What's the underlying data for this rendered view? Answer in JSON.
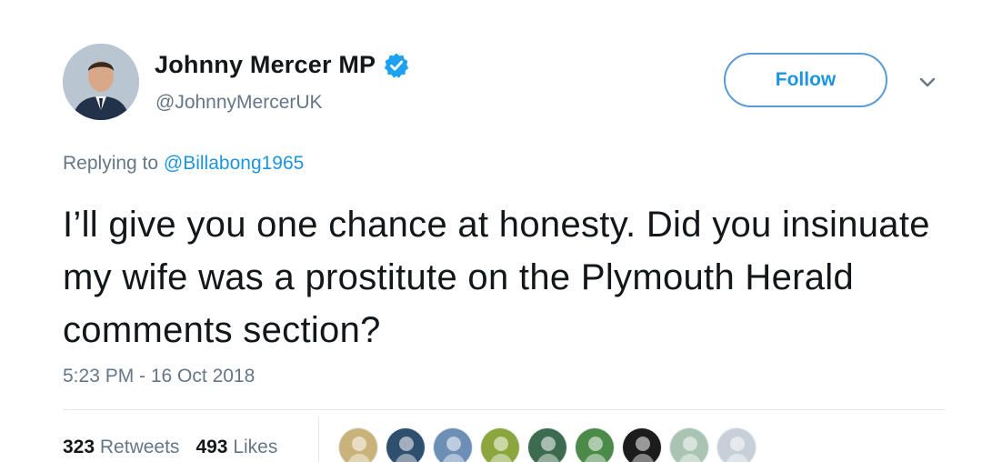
{
  "author": {
    "display_name": "Johnny Mercer MP",
    "handle": "@JohnnyMercerUK",
    "verified": true,
    "avatar_icon": "profile-photo"
  },
  "actions": {
    "follow_label": "Follow",
    "menu_icon": "chevron-down-icon"
  },
  "reply": {
    "prefix": "Replying to",
    "mention": "@Billabong1965"
  },
  "tweet": {
    "text": "I’ll give you one chance at honesty. Did you insinuate my wife was a prostitute on the Plymouth Herald comments section?",
    "timestamp": "5:23 PM - 16 Oct 2018"
  },
  "stats": {
    "retweets_count": "323",
    "retweets_label": "Retweets",
    "likes_count": "493",
    "likes_label": "Likes"
  },
  "likers": [
    {
      "name": "liker-avatar-1",
      "color": "#c9b37a"
    },
    {
      "name": "liker-avatar-2",
      "color": "#2f4f6f"
    },
    {
      "name": "liker-avatar-3",
      "color": "#6d8fb5"
    },
    {
      "name": "liker-avatar-4",
      "color": "#8aa63c"
    },
    {
      "name": "liker-avatar-5",
      "color": "#3d6b4f"
    },
    {
      "name": "liker-avatar-6",
      "color": "#4c8a4a"
    },
    {
      "name": "liker-avatar-7",
      "color": "#1c1c1c"
    },
    {
      "name": "liker-avatar-8",
      "color": "#a9c4b0"
    },
    {
      "name": "liker-avatar-9",
      "color": "#c7d0d8"
    }
  ],
  "colors": {
    "link_blue": "#1b95e0",
    "muted_gray": "#657786",
    "text_dark": "#14171a",
    "verified_blue": "#1da1f2"
  }
}
